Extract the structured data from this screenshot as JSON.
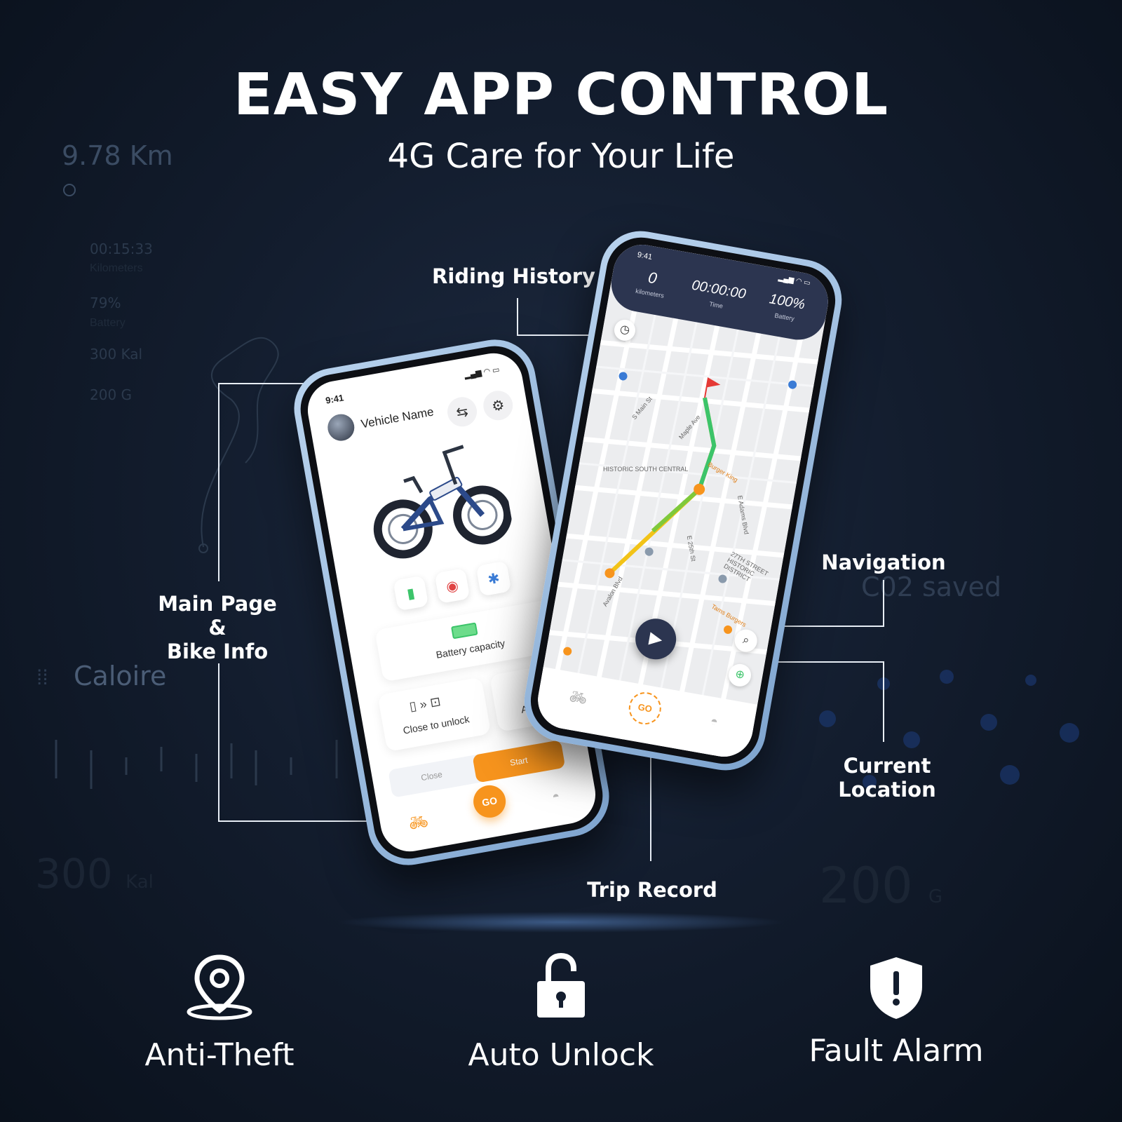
{
  "header": {
    "title": "EASY APP CONTROL",
    "subtitle": "4G Care for Your Life"
  },
  "background_stats": {
    "distance": "9.78 Km",
    "time": "00:15:33",
    "time_label": "Kilometers",
    "battery": "79%",
    "battery_label": "Battery",
    "calories": "300 Kal",
    "grams": "200 G",
    "caloire": "Caloire",
    "co2": "C02 saved",
    "big_cal_value": "300",
    "big_cal_unit": "Kal",
    "big_g_value": "200",
    "big_g_unit": "G"
  },
  "callouts": {
    "riding_history": "Riding History",
    "main_page": [
      "Main Page",
      "&",
      "Bike Info"
    ],
    "navigation": "Navigation",
    "current_location": [
      "Current",
      "Location"
    ],
    "trip_record": "Trip Record"
  },
  "left_phone": {
    "status_time": "9:41",
    "vehicle_name": "Vehicle Name",
    "battery_label": "Battery capacity",
    "close_to_unlock": "Close to unlock",
    "auto_label": "Auto",
    "close_button": "Close",
    "start_button": "Start",
    "go_label": "GO"
  },
  "right_phone": {
    "status_time": "9:41",
    "distance_value": "0",
    "distance_label": "kilometers",
    "time_value": "00:00:00",
    "time_label": "Time",
    "battery_value": "100%",
    "battery_label": "Battery",
    "go_label": "GO",
    "map_labels": [
      "HISTORIC SOUTH CENTRAL",
      "Maple Ave",
      "S Main St",
      "E Adams Blvd",
      "Burger King",
      "E 25th St",
      "Avalon Blvd",
      "27TH STREET HISTORIC DISTRICT",
      "Tams Burgers"
    ]
  },
  "features": [
    {
      "label": "Anti-Theft",
      "icon": "map-pin-icon"
    },
    {
      "label": "Auto Unlock",
      "icon": "unlocked-padlock-icon"
    },
    {
      "label": "Fault Alarm",
      "icon": "shield-alert-icon"
    }
  ],
  "colors": {
    "background": "#131d2e",
    "accent_orange": "#f7941d",
    "phone_frame": "#a9c6e6",
    "route_green": "#3cc46a",
    "route_yellow": "#f2c318"
  }
}
